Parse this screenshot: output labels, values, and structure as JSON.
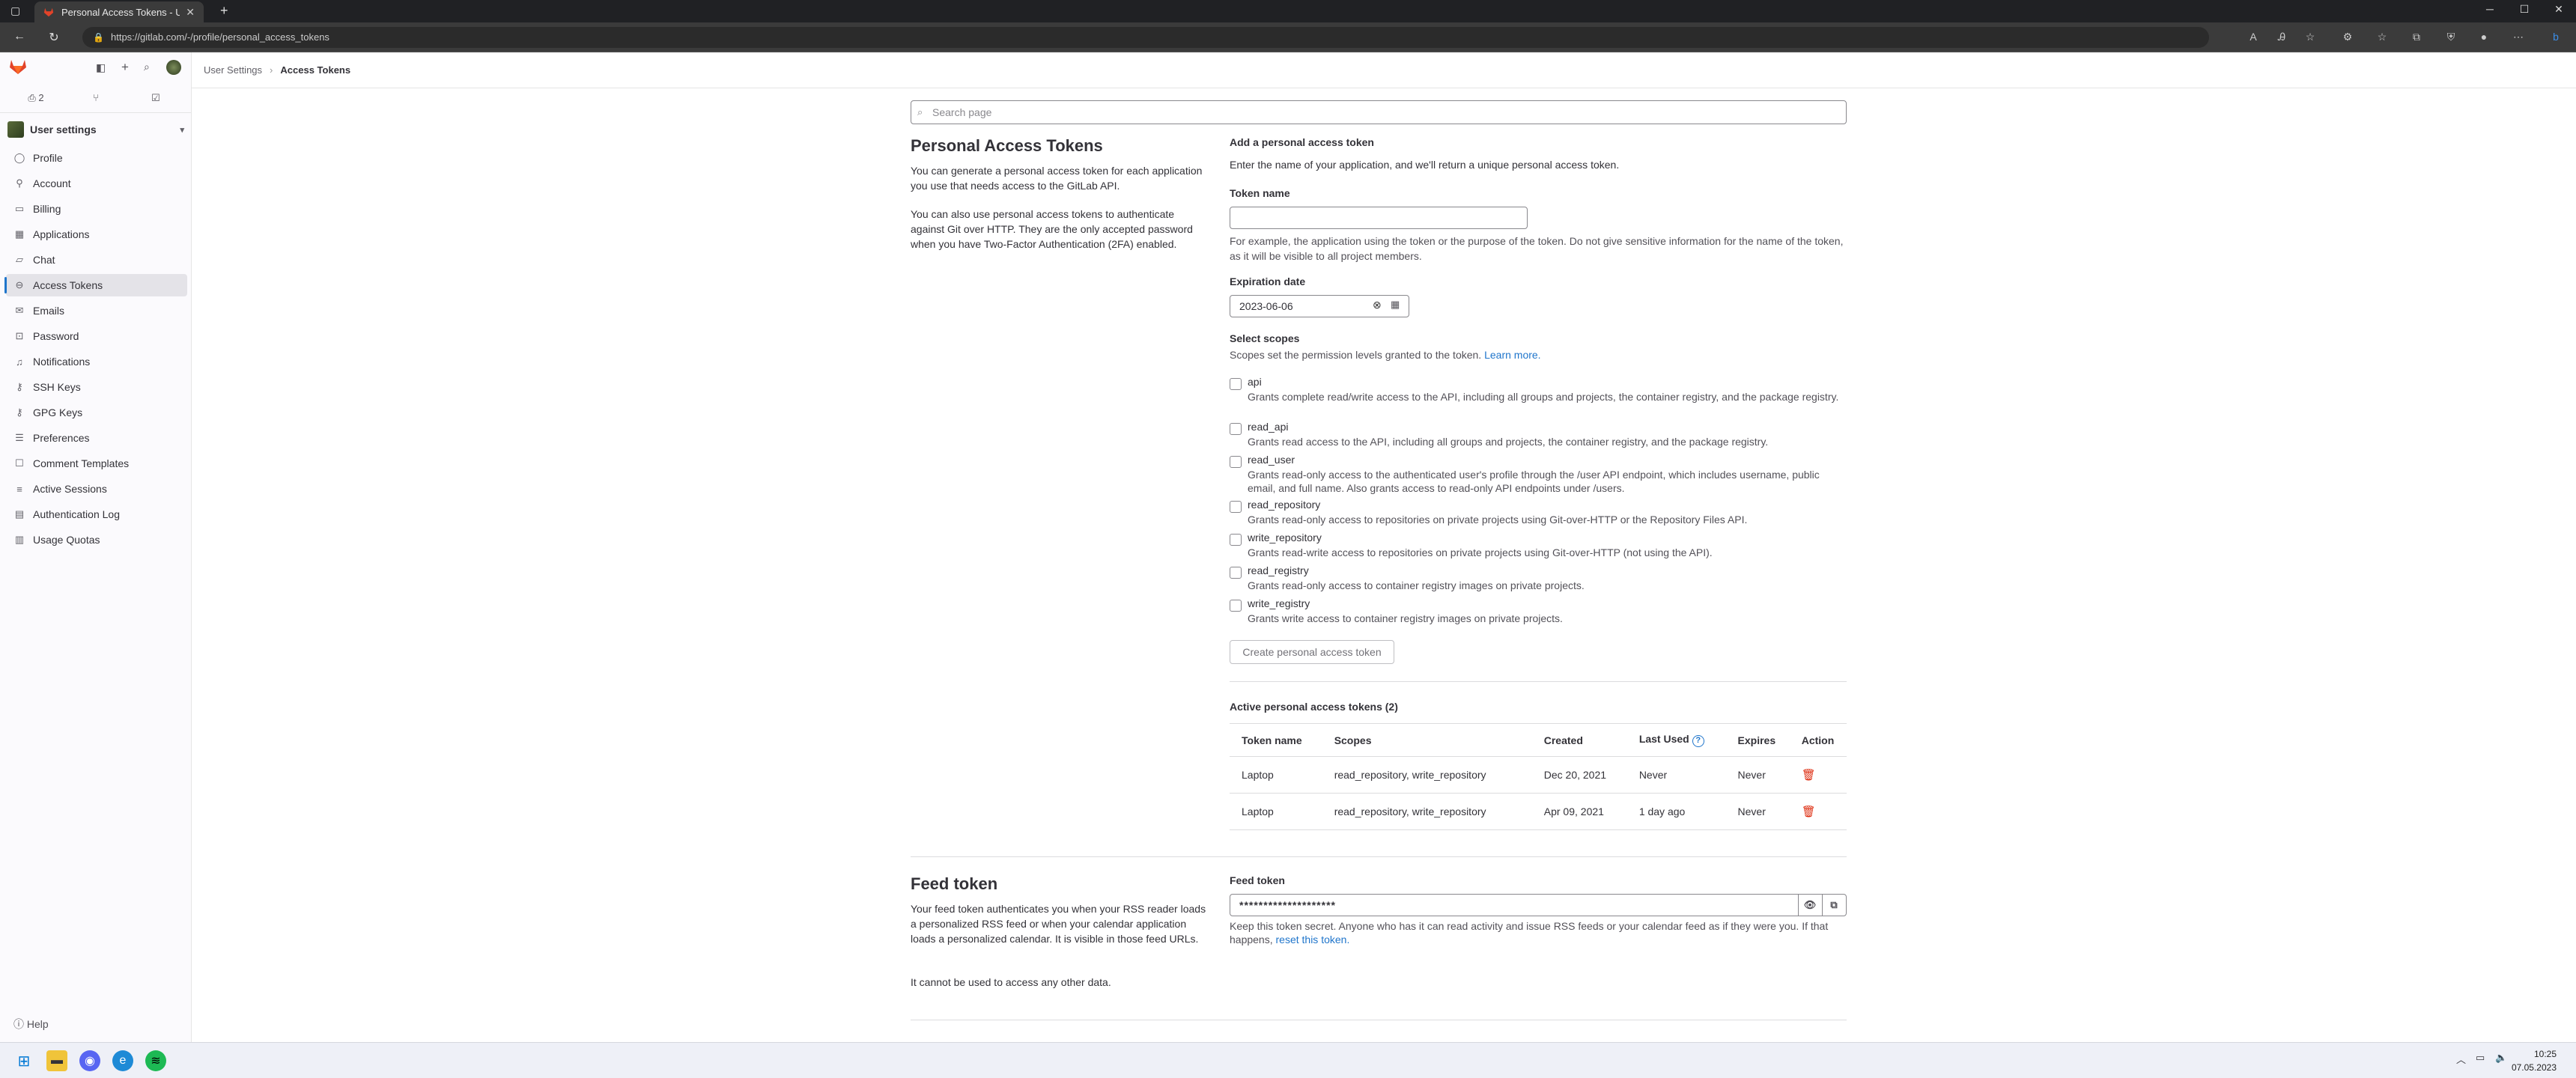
{
  "browser": {
    "tab_title": "Personal Access Tokens - User Se",
    "url": "https://gitlab.com/-/profile/personal_access_tokens"
  },
  "sidebar": {
    "issues_count": "2",
    "context_title": "User settings",
    "items": [
      {
        "label": "Profile",
        "icon": "user-icon"
      },
      {
        "label": "Account",
        "icon": "account-icon"
      },
      {
        "label": "Billing",
        "icon": "billing-icon"
      },
      {
        "label": "Applications",
        "icon": "applications-icon"
      },
      {
        "label": "Chat",
        "icon": "chat-icon"
      },
      {
        "label": "Access Tokens",
        "icon": "token-icon",
        "active": true
      },
      {
        "label": "Emails",
        "icon": "mail-icon"
      },
      {
        "label": "Password",
        "icon": "lock-icon"
      },
      {
        "label": "Notifications",
        "icon": "bell-icon"
      },
      {
        "label": "SSH Keys",
        "icon": "key-icon"
      },
      {
        "label": "GPG Keys",
        "icon": "key-icon"
      },
      {
        "label": "Preferences",
        "icon": "preferences-icon"
      },
      {
        "label": "Comment Templates",
        "icon": "comment-icon"
      },
      {
        "label": "Active Sessions",
        "icon": "sessions-icon"
      },
      {
        "label": "Authentication Log",
        "icon": "log-icon"
      },
      {
        "label": "Usage Quotas",
        "icon": "quota-icon"
      }
    ],
    "help": "Help"
  },
  "breadcrumb": {
    "parent": "User Settings",
    "current": "Access Tokens"
  },
  "search": {
    "placeholder": "Search page"
  },
  "pat": {
    "title": "Personal Access Tokens",
    "desc1": "You can generate a personal access token for each application you use that needs access to the GitLab API.",
    "desc2": "You can also use personal access tokens to authenticate against Git over HTTP. They are the only accepted password when you have Two-Factor Authentication (2FA) enabled.",
    "add_heading": "Add a personal access token",
    "add_desc": "Enter the name of your application, and we'll return a unique personal access token.",
    "token_name_label": "Token name",
    "token_name_value": "",
    "token_name_help": "For example, the application using the token or the purpose of the token. Do not give sensitive information for the name of the token, as it will be visible to all project members.",
    "expiration_label": "Expiration date",
    "expiration_value": "2023-06-06",
    "scopes_label": "Select scopes",
    "scopes_help": "Scopes set the permission levels granted to the token.",
    "learn_more": "Learn more.",
    "scopes": [
      {
        "name": "api",
        "desc": "Grants complete read/write access to the API, including all groups and projects, the container registry, and the package registry."
      },
      {
        "name": "read_api",
        "desc": "Grants read access to the API, including all groups and projects, the container registry, and the package registry."
      },
      {
        "name": "read_user",
        "desc": "Grants read-only access to the authenticated user's profile through the /user API endpoint, which includes username, public email, and full name. Also grants access to read-only API endpoints under /users."
      },
      {
        "name": "read_repository",
        "desc": "Grants read-only access to repositories on private projects using Git-over-HTTP or the Repository Files API."
      },
      {
        "name": "write_repository",
        "desc": "Grants read-write access to repositories on private projects using Git-over-HTTP (not using the API)."
      },
      {
        "name": "read_registry",
        "desc": "Grants read-only access to container registry images on private projects."
      },
      {
        "name": "write_registry",
        "desc": "Grants write access to container registry images on private projects."
      }
    ],
    "create_button": "Create personal access token"
  },
  "active_tokens": {
    "heading": "Active personal access tokens (2)",
    "columns": [
      "Token name",
      "Scopes",
      "Created",
      "Last Used",
      "Expires",
      "Action"
    ],
    "rows": [
      {
        "name": "Laptop",
        "scopes": "read_repository, write_repository",
        "created": "Dec 20, 2021",
        "last_used": "Never",
        "expires": "Never"
      },
      {
        "name": "Laptop",
        "scopes": "read_repository, write_repository",
        "created": "Apr 09, 2021",
        "last_used": "1 day ago",
        "expires": "Never"
      }
    ]
  },
  "feed": {
    "title": "Feed token",
    "desc1": "Your feed token authenticates you when your RSS reader loads a personalized RSS feed or when your calendar application loads a personalized calendar. It is visible in those feed URLs.",
    "desc2": "It cannot be used to access any other data.",
    "label": "Feed token",
    "value": "********************",
    "help": "Keep this token secret. Anyone who has it can read activity and issue RSS feeds or your calendar feed as if they were you. If that happens,",
    "reset_link": "reset this token."
  },
  "taskbar": {
    "time": "10:25",
    "date": "07.05.2023"
  },
  "colors": {
    "accent": "#1f75cb",
    "sidebar_bg": "#fbfafd",
    "active_bg": "#e4e3e8"
  }
}
